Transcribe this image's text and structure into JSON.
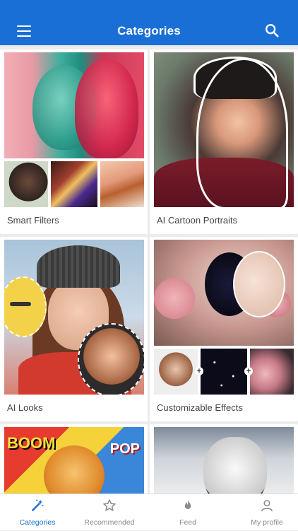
{
  "header": {
    "title": "Categories",
    "menu_icon": "menu-icon",
    "search_icon": "search-icon",
    "color": "#1a6fd6"
  },
  "categories": [
    {
      "label": "Smart Filters"
    },
    {
      "label": "AI Cartoon Portraits"
    },
    {
      "label": "AI Looks"
    },
    {
      "label": "Customizable Effects"
    }
  ],
  "partial_tiles": {
    "left_text_1": "BOOM",
    "left_text_2": "POP"
  },
  "bottom_nav": {
    "items": [
      {
        "label": "Categories",
        "icon": "magic-wand-icon",
        "active": true
      },
      {
        "label": "Recommended",
        "icon": "star-icon",
        "active": false
      },
      {
        "label": "Feed",
        "icon": "flame-icon",
        "active": false
      },
      {
        "label": "My profile",
        "icon": "profile-icon",
        "active": false
      }
    ],
    "active_color": "#1a6fd6",
    "inactive_color": "#8a8a8a"
  }
}
